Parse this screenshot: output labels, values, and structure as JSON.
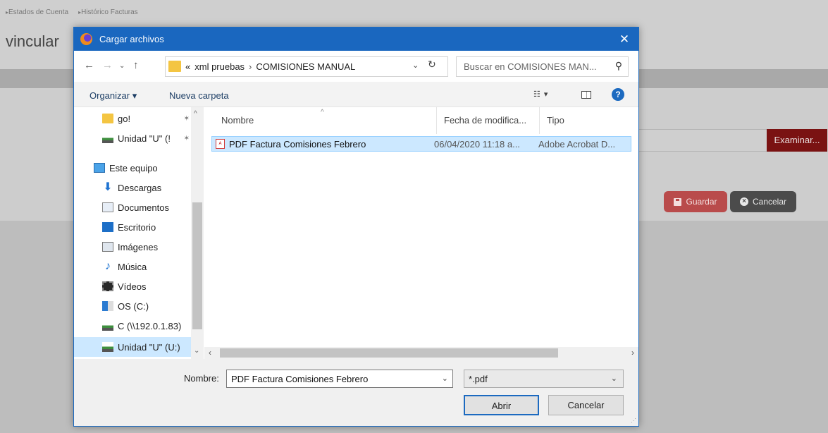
{
  "background_page": {
    "breadcrumbs": [
      "Estados de Cuenta",
      "Histórico Facturas"
    ],
    "page_title": "vincular",
    "examinar_label": "Examinar...",
    "guardar_label": "Guardar",
    "cancelar_label": "Cancelar",
    "colors": {
      "examinar": "#7a1212",
      "guardar": "#b94b4b",
      "cancelar": "#4b4b4b"
    }
  },
  "dialog": {
    "title": "Cargar archivos",
    "close_glyph": "✕",
    "address": {
      "overflow": "«",
      "path": [
        "xml pruebas",
        "COMISIONES MANUAL"
      ],
      "separator": "›"
    },
    "search_placeholder": "Buscar en COMISIONES MAN...",
    "commands": {
      "organize": "Organizar ▾",
      "new_folder": "Nueva carpeta"
    },
    "nav_items": [
      {
        "label": "go!",
        "icon": "folder-icon"
      },
      {
        "label": "Unidad \"U\" (!",
        "icon": "network-drive-icon"
      },
      {
        "label": "Este equipo",
        "icon": "computer-icon"
      },
      {
        "label": "Descargas",
        "icon": "downloads-icon"
      },
      {
        "label": "Documentos",
        "icon": "documents-icon"
      },
      {
        "label": "Escritorio",
        "icon": "desktop-icon"
      },
      {
        "label": "Imágenes",
        "icon": "pictures-icon"
      },
      {
        "label": "Música",
        "icon": "music-icon"
      },
      {
        "label": "Vídeos",
        "icon": "videos-icon"
      },
      {
        "label": "OS (C:)",
        "icon": "os-drive-icon"
      },
      {
        "label": "C (\\\\192.0.1.83)",
        "icon": "network-drive-icon"
      },
      {
        "label": "Unidad \"U\" (U:)",
        "icon": "network-drive-icon",
        "selected": true
      }
    ],
    "columns": {
      "name": "Nombre",
      "date": "Fecha de modifica...",
      "type": "Tipo"
    },
    "files": [
      {
        "name": "PDF Factura Comisiones Febrero",
        "date": "06/04/2020 11:18 a...",
        "type": "Adobe Acrobat D..."
      }
    ],
    "filename_label": "Nombre:",
    "filename_value": "PDF Factura Comisiones Febrero",
    "filter_value": "*.pdf",
    "open_label": "Abrir",
    "cancel_label": "Cancelar",
    "accent_color": "#1a67bf"
  }
}
